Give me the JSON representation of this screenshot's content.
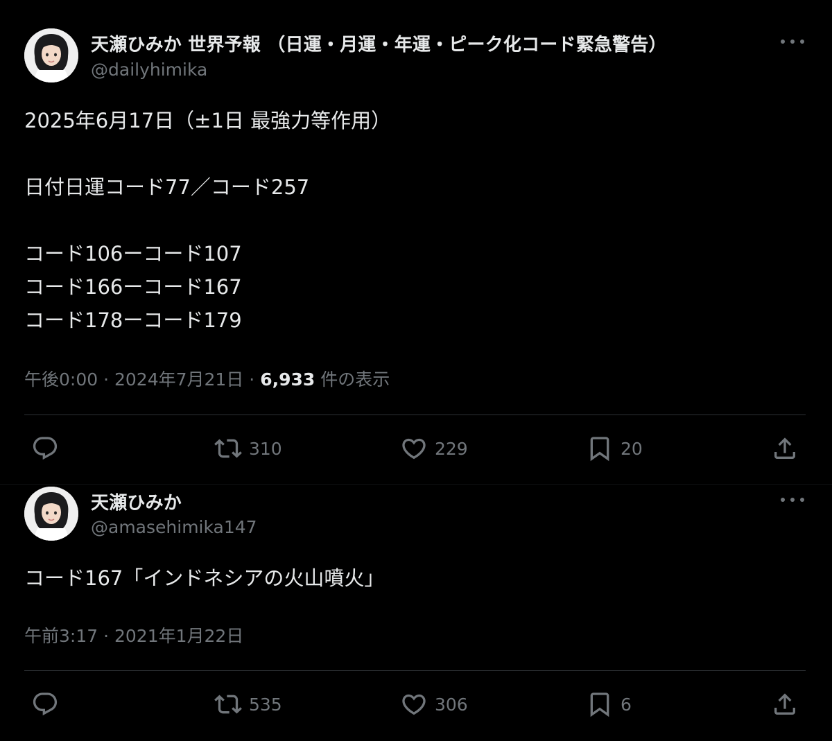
{
  "tweets": [
    {
      "display_name": "天瀬ひみか 世界予報 （日運・月運・年運・ピーク化コード緊急警告）",
      "handle": "@dailyhimika",
      "text_lines": [
        "2025年6月17日（±1日 最強力等作用）",
        "",
        "日付日運コード77／コード257",
        "",
        "コード106ーコード107",
        "コード166ーコード167",
        "コード178ーコード179"
      ],
      "time": "午後0:00",
      "date": "2024年7月21日",
      "views_count": "6,933",
      "views_label": "件の表示",
      "retweets": "310",
      "likes": "229",
      "bookmarks": "20"
    },
    {
      "display_name": "天瀬ひみか",
      "handle": "@amasehimika147",
      "text_lines": [
        "コード167「インドネシアの火山噴火」"
      ],
      "time": "午前3:17",
      "date": "2021年1月22日",
      "retweets": "535",
      "likes": "306",
      "bookmarks": "6"
    }
  ],
  "colors": {
    "background": "#000000",
    "text_primary": "#e7e9ea",
    "text_secondary": "#71767b",
    "divider": "#2f3336"
  },
  "icons": [
    "reply-icon",
    "retweet-icon",
    "like-icon",
    "bookmark-icon",
    "share-icon",
    "more-icon"
  ]
}
